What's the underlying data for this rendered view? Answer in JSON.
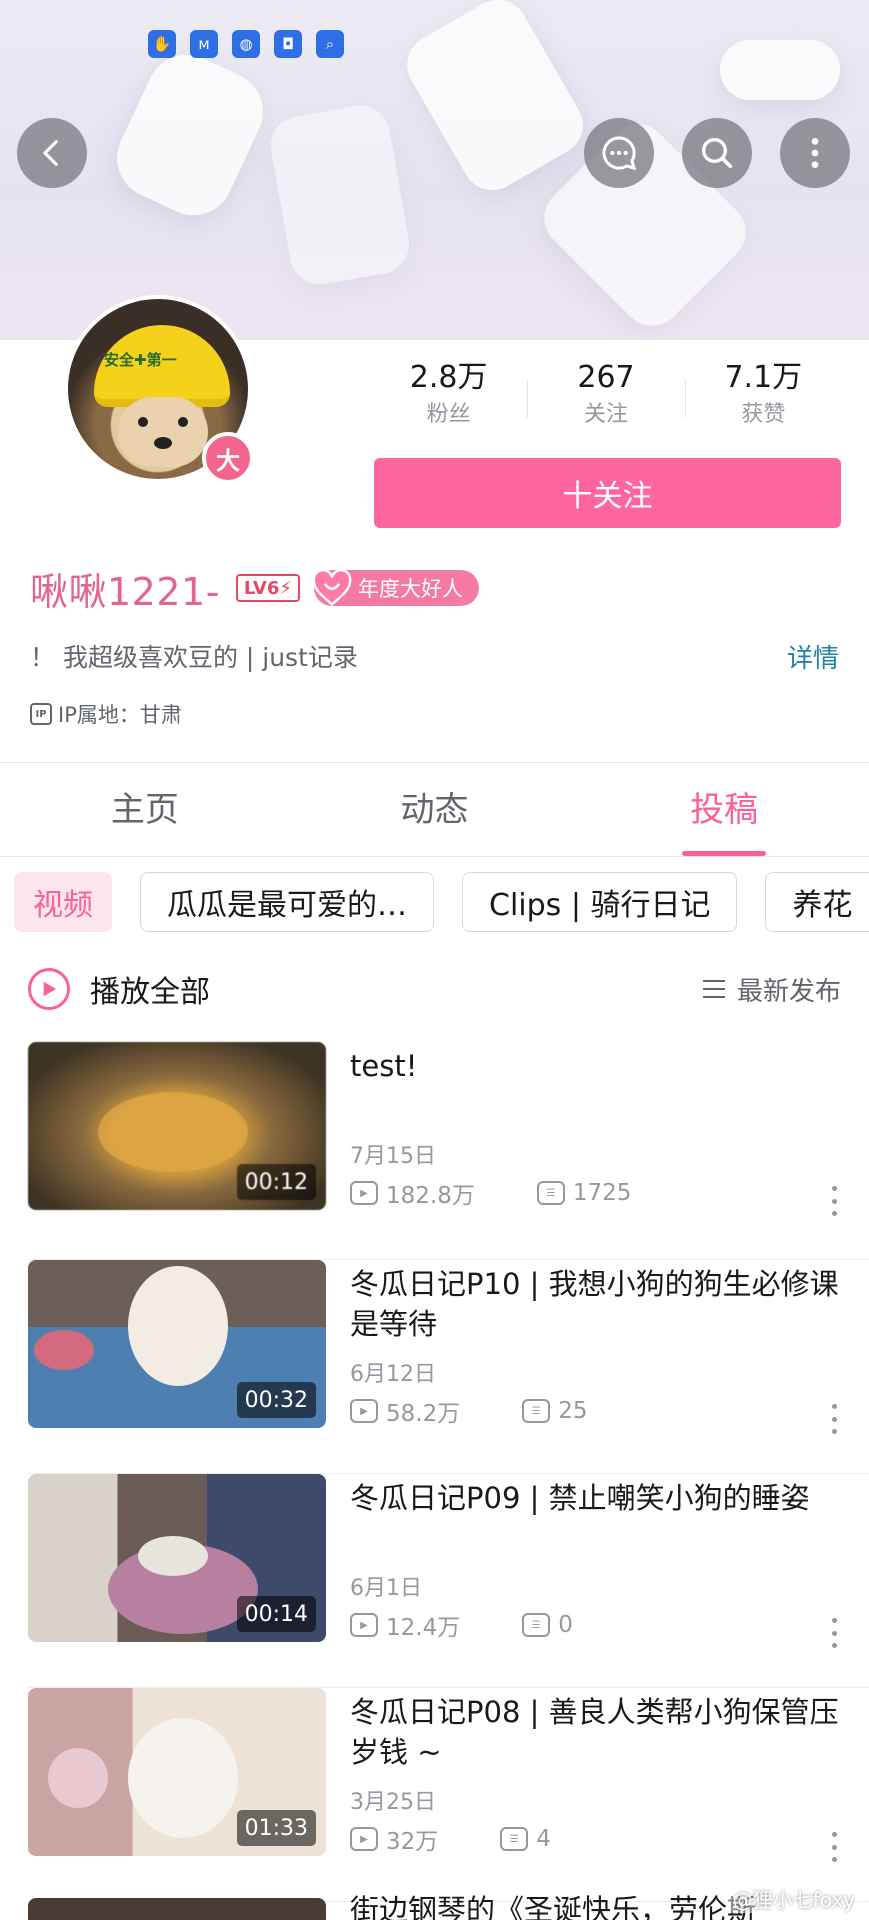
{
  "status_icons": [
    "app-icon-1",
    "app-icon-2",
    "globe-icon",
    "gamepad-icon",
    "search-icon"
  ],
  "header_actions": [
    "back-icon",
    "chat-bubble-icon",
    "search-icon",
    "more-vertical-icon"
  ],
  "profile": {
    "avatar_badge": "大",
    "helmet_text": "安全✚第一",
    "stats": [
      {
        "value": "2.8万",
        "label": "粉丝"
      },
      {
        "value": "267",
        "label": "关注"
      },
      {
        "value": "7.1万",
        "label": "获赞"
      }
    ],
    "follow_label": "十关注",
    "username": "啾啾1221-",
    "level_badge": "LV6⚡",
    "annual_badge": "年度大好人",
    "bio": "！ 我超级喜欢豆的 | just记录",
    "detail_link": "详情",
    "ip_icon": "IP",
    "ip_location": "IP属地：甘肃"
  },
  "tabs": [
    {
      "label": "主页",
      "active": false
    },
    {
      "label": "动态",
      "active": false
    },
    {
      "label": "投稿",
      "active": true
    }
  ],
  "chips": [
    {
      "label": "视频",
      "active": true
    },
    {
      "label": "瓜瓜是最可爱的…",
      "active": false
    },
    {
      "label": "Clips | 骑行日记",
      "active": false
    },
    {
      "label": "养花",
      "active": false
    }
  ],
  "play_all_label": "播放全部",
  "sort_label": "最新发布",
  "videos": [
    {
      "title": "test!",
      "date": "7月15日",
      "views": "182.8万",
      "comments": "1725",
      "duration": "00:12"
    },
    {
      "title": "冬瓜日记P10 | 我想小狗的狗生必修课是等待",
      "date": "6月12日",
      "views": "58.2万",
      "comments": "25",
      "duration": "00:32"
    },
    {
      "title": "冬瓜日记P09 | 禁止嘲笑小狗的睡姿",
      "date": "6月1日",
      "views": "12.4万",
      "comments": "0",
      "duration": "00:14"
    },
    {
      "title": "冬瓜日记P08 | 善良人类帮小狗保管压岁钱 ~",
      "date": "3月25日",
      "views": "32万",
      "comments": "4",
      "duration": "01:33"
    }
  ],
  "partial_video_title": "街边钢琴的《圣诞快乐，劳伦斯",
  "watermark": "@狸小七foxy",
  "colors": {
    "accent_pink": "#ff5f98",
    "follow_button": "#ff66a0",
    "username": "#e2658c",
    "link_blue": "#1f82a6"
  }
}
